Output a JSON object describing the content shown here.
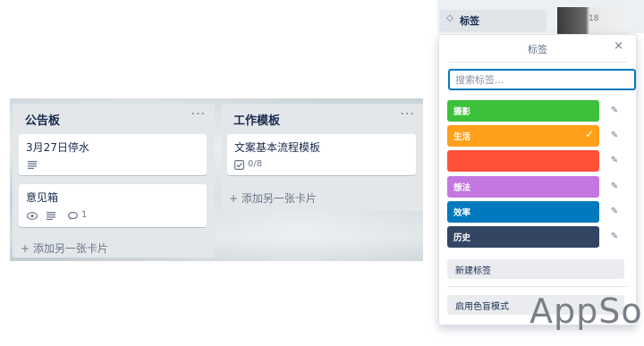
{
  "board": {
    "lists": [
      {
        "title": "公告板",
        "cards": [
          {
            "title": "3月27日停水"
          },
          {
            "title": "意见箱",
            "comments": "1"
          }
        ],
        "add_card": "+ 添加另一张卡片"
      },
      {
        "title": "工作模板",
        "cards": [
          {
            "title": "文案基本流程模板",
            "checklist": "0/8"
          }
        ],
        "add_card": "+ 添加另一张卡片"
      }
    ],
    "menu_glyph": "···"
  },
  "sidebar": {
    "labels_button": "标签",
    "thumb_count": "18"
  },
  "popover": {
    "title": "标签",
    "close": "×",
    "search_placeholder": "搜索标签...",
    "labels": [
      {
        "name": "摄影",
        "color": "#3cc13b",
        "selected": false
      },
      {
        "name": "生活",
        "color": "#ff9f1a",
        "selected": true
      },
      {
        "name": "",
        "color": "#ff5138",
        "selected": false
      },
      {
        "name": "想法",
        "color": "#c377e0",
        "selected": false
      },
      {
        "name": "效率",
        "color": "#0079bf",
        "selected": false
      },
      {
        "name": "历史",
        "color": "#344563",
        "selected": false
      }
    ],
    "check": "✓",
    "new_label": "新建标签",
    "colorblind": "启用色盲模式"
  },
  "watermark": "AppSo",
  "icons": {
    "description": "description-icon",
    "eye": "eye-icon",
    "comment": "comment-icon",
    "checklist": "checklist-icon",
    "pencil": "pencil-icon",
    "tag": "tag-icon"
  }
}
